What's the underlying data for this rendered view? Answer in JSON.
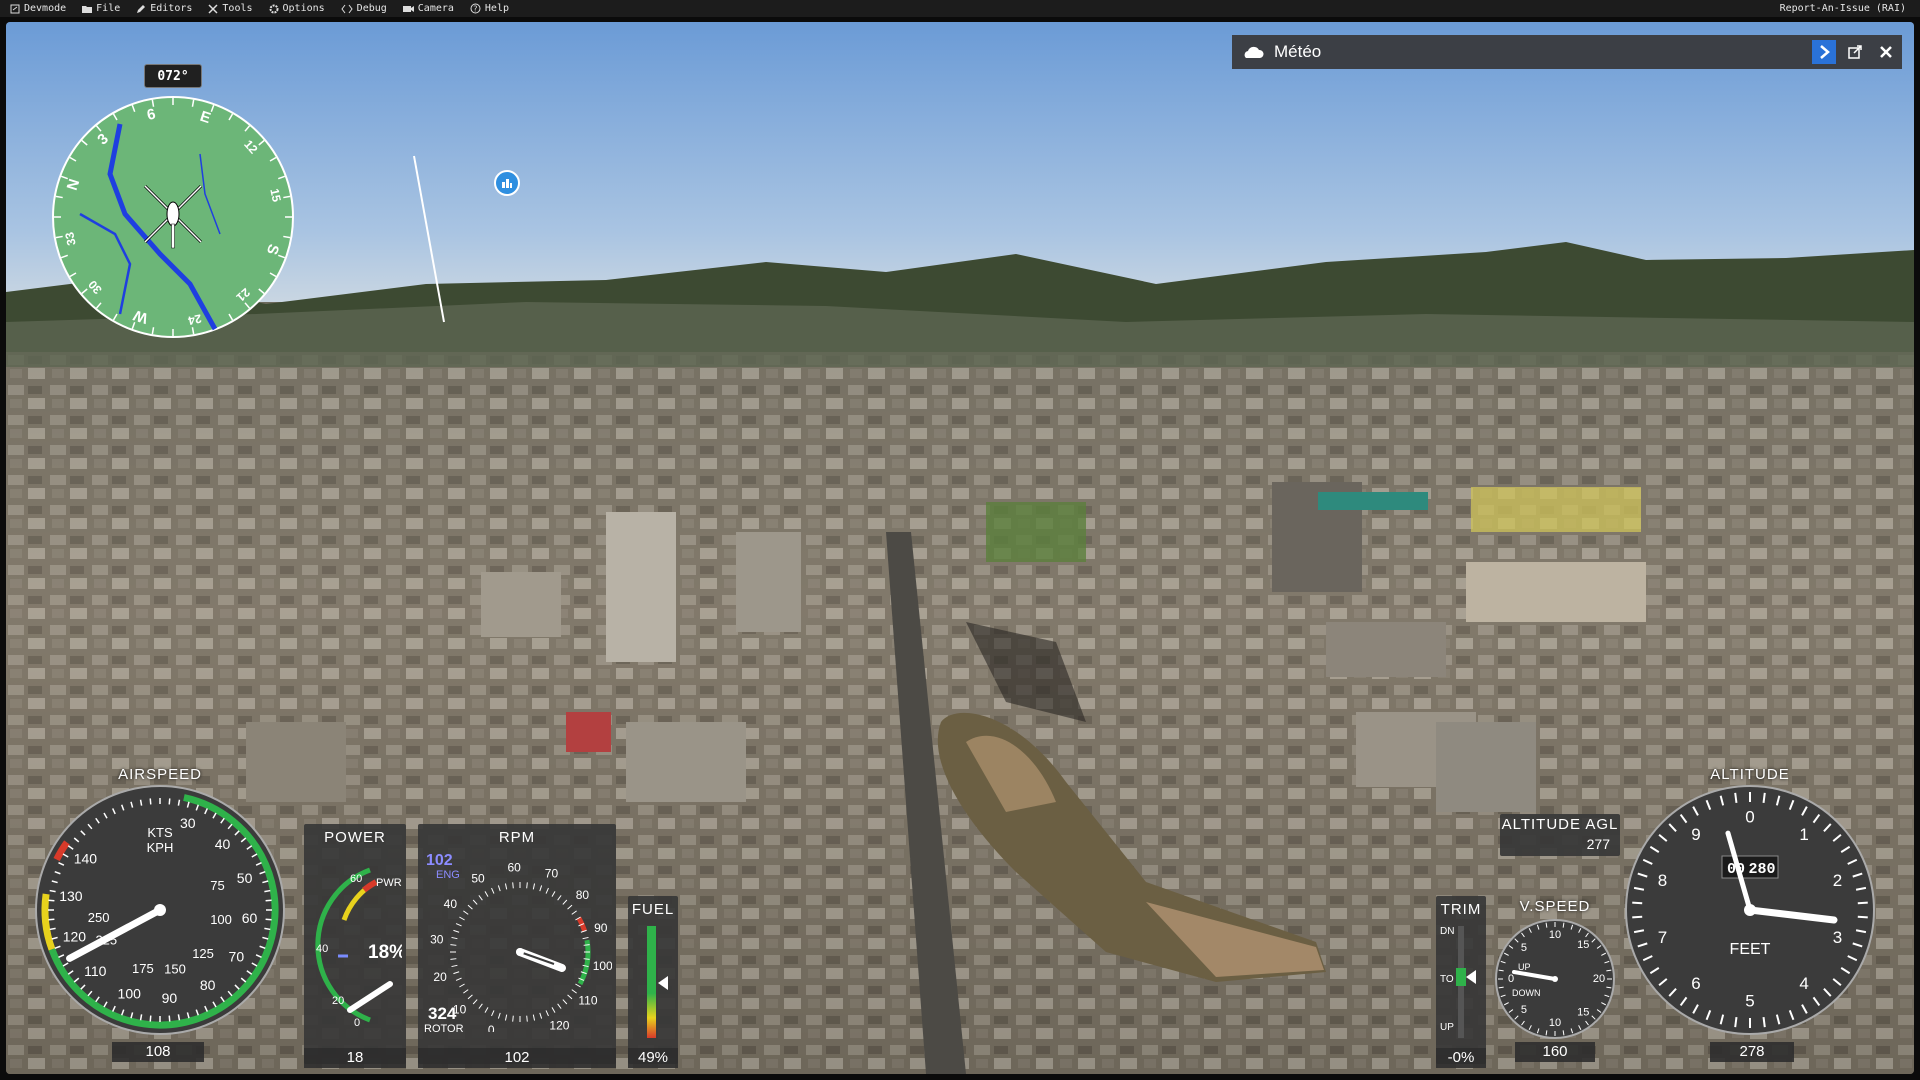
{
  "menubar": {
    "items": [
      "Devmode",
      "File",
      "Editors",
      "Tools",
      "Options",
      "Debug",
      "Camera",
      "Help"
    ],
    "right_label": "Report-An-Issue (RAI)"
  },
  "weather_panel": {
    "title": "Météo",
    "icon": "cloud-icon",
    "buttons": [
      "chevron-right-icon",
      "popout-icon",
      "close-icon"
    ]
  },
  "compass": {
    "heading_label": "072°",
    "heading": 72,
    "labels": [
      "N",
      "3",
      "6",
      "E",
      "12",
      "15",
      "S",
      "21",
      "24",
      "W",
      "30",
      "33"
    ]
  },
  "airspeed": {
    "title": "AIRSPEED",
    "unit_kts": "KTS",
    "unit_kph": "KPH",
    "kts_ticks": [
      "30",
      "40",
      "50",
      "60",
      "70",
      "80",
      "90",
      "100",
      "110",
      "120",
      "130",
      "140"
    ],
    "kph_ticks": [
      "75",
      "100",
      "125",
      "150",
      "175",
      "225",
      "250"
    ],
    "value": "108"
  },
  "power": {
    "title": "POWER",
    "sub": "PWR",
    "ticks": [
      "0",
      "20",
      "40",
      "60"
    ],
    "percent": "18%",
    "value": "18"
  },
  "rpm": {
    "title": "RPM",
    "eng_value": "102",
    "eng_label": "ENG",
    "rotor_value": "324",
    "rotor_label": "ROTOR",
    "ticks": [
      "0",
      "10",
      "20",
      "30",
      "40",
      "50",
      "60",
      "70",
      "80",
      "90",
      "100",
      "110",
      "120"
    ],
    "value": "102"
  },
  "fuel": {
    "title": "FUEL",
    "value": "49%",
    "level": 0.49
  },
  "trim": {
    "title": "TRIM",
    "dn": "DN",
    "to": "TO",
    "up": "UP",
    "value": "-0%"
  },
  "vspeed": {
    "title": "V.SPEED",
    "up": "UP",
    "down": "DOWN",
    "ticks": [
      "0",
      "5",
      "10",
      "15",
      "20",
      "15",
      "10",
      "5"
    ],
    "value": "160"
  },
  "altitude_agl": {
    "title": "ALTITUDE AGL",
    "value": "277"
  },
  "altitude": {
    "title": "ALTITUDE",
    "unit": "FEET",
    "ticks": [
      "0",
      "1",
      "2",
      "3",
      "4",
      "5",
      "6",
      "7",
      "8",
      "9"
    ],
    "drum": "00",
    "drum_roll": "280",
    "value": "278"
  },
  "colors": {
    "gauge_green": "#2fb24a",
    "gauge_yellow": "#e8d21d",
    "gauge_red": "#d83a2a",
    "panel_bg": "#373737",
    "sky_top": "#6f9fd8",
    "sky_bottom": "#c9d8e6",
    "map_green": "#6fb77b",
    "river_blue": "#1f3fe0"
  }
}
